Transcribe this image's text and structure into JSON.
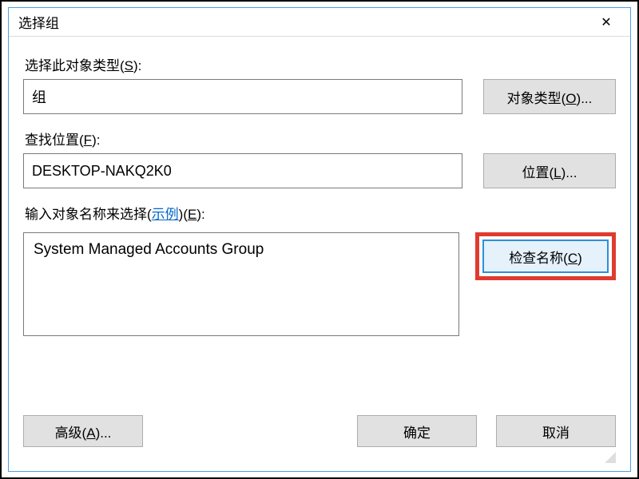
{
  "title": "选择组",
  "labels": {
    "object_type": "选择此对象类型(",
    "object_type_key": "S",
    "object_type_suffix": "):",
    "from_location": "查找位置(",
    "from_location_key": "F",
    "from_location_suffix": "):",
    "enter_names_prefix": "输入对象名称来选择(",
    "enter_names_example": "示例",
    "enter_names_mid": ")(",
    "enter_names_key": "E",
    "enter_names_suffix": "):"
  },
  "values": {
    "object_type": "组",
    "location": "DESKTOP-NAKQ2K0",
    "names": "System Managed Accounts Group"
  },
  "buttons": {
    "object_types_pre": "对象类型(",
    "object_types_key": "O",
    "object_types_post": ")...",
    "locations_pre": "位置(",
    "locations_key": "L",
    "locations_post": ")...",
    "check_pre": "检查名称(",
    "check_key": "C",
    "check_post": ")",
    "advanced_pre": "高级(",
    "advanced_key": "A",
    "advanced_post": ")...",
    "ok": "确定",
    "cancel": "取消"
  }
}
